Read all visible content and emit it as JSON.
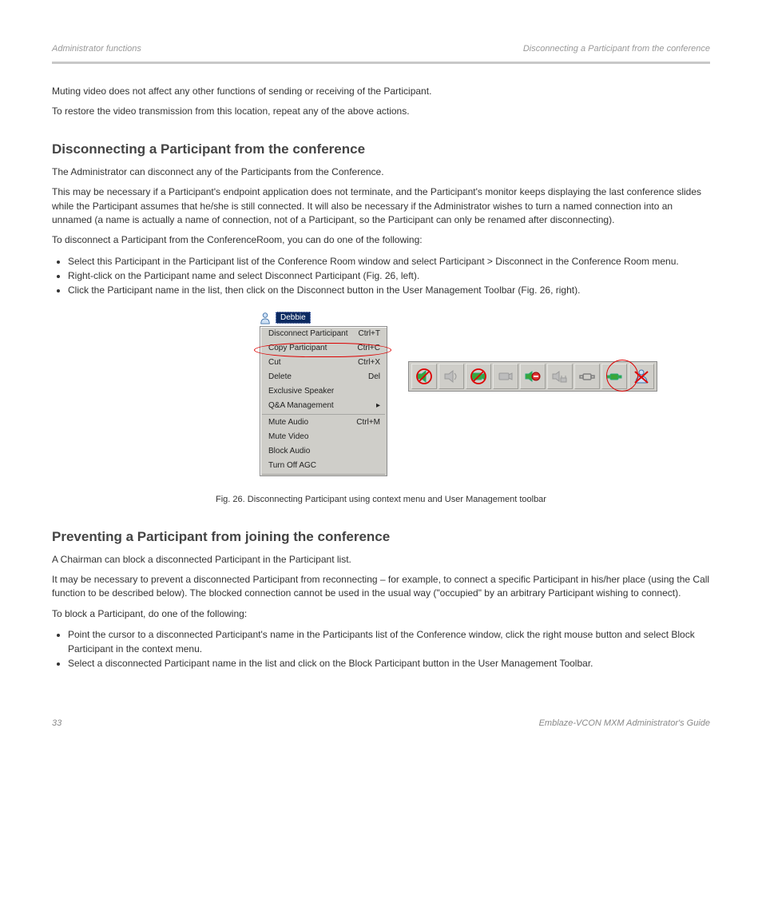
{
  "header": {
    "left": "Administrator functions",
    "right": "Disconnecting a Participant from the conference"
  },
  "intro_paragraphs": [
    "Muting video does not affect any other functions of sending or receiving of the Participant.",
    "To restore the video transmission from this location, repeat any of the above actions."
  ],
  "sections": [
    {
      "heading": "Disconnecting a Participant from the conference",
      "paragraphs": [
        "The Administrator can disconnect any of the Participants from the Conference.",
        "This may be necessary if a Participant's endpoint application does not terminate, and the Participant's monitor keeps displaying the last conference slides while the Participant assumes that he/she is still connected. It will also be necessary if the Administrator wishes to turn a named connection into an unnamed (a name is actually a name of connection, not of a Participant, so the Participant can only be renamed after disconnecting)."
      ],
      "action_intro": "To disconnect a Participant from the ConferenceRoom, you can do one of the following:",
      "bullets": [
        "Select this Participant in the Participant list of the Conference Room window and select Participant > Disconnect in the Conference Room menu.",
        "Right-click on the Participant name and select Disconnect Participant (Fig. 26, left).",
        "Click the Participant name in the list, then click on the Disconnect button in the User Management Toolbar (Fig. 26, right)."
      ],
      "fig_caption": "Fig. 26. Disconnecting Participant using context menu and User Management toolbar"
    },
    {
      "heading": "Preventing a Participant from joining the conference",
      "paragraphs": [
        "A Chairman can block a disconnected Participant in the Participant list.",
        "It may be necessary to prevent a disconnected Participant from reconnecting – for example, to connect a specific Participant in his/her place (using the Call function to be described below). The blocked connection cannot be used in the usual way (\"occupied\" by an arbitrary Participant wishing to connect)."
      ],
      "action_intro": "To block a Participant, do one of the following:",
      "bullets": [
        "Point the cursor to a disconnected Participant's name in the Participants list of the Conference window, click the right mouse button and select Block Participant in the context menu.",
        "Select a disconnected Participant name in the list and click on the Block Participant button in the User Management Toolbar."
      ]
    }
  ],
  "participant_name": "Debbie",
  "context_menu": {
    "items": [
      {
        "label": "Disconnect Participant",
        "shortcut": "Ctrl+T"
      },
      {
        "label": "Copy Participant",
        "shortcut": "Ctrl+C"
      },
      {
        "label": "Cut",
        "shortcut": "Ctrl+X"
      },
      {
        "label": "Delete",
        "shortcut": "Del"
      },
      {
        "label": "Exclusive Speaker",
        "shortcut": ""
      },
      {
        "label": "Q&A Management",
        "shortcut": "▸"
      }
    ],
    "items2": [
      {
        "label": "Mute Audio",
        "shortcut": "Ctrl+M"
      },
      {
        "label": "Mute Video",
        "shortcut": ""
      },
      {
        "label": "Block Audio",
        "shortcut": ""
      },
      {
        "label": "Turn Off AGC",
        "shortcut": ""
      }
    ]
  },
  "toolbar_icons": [
    "mute-audio-icon",
    "speaker-off-icon",
    "mute-video-icon",
    "camera-off-icon",
    "block-audio-icon",
    "agc-icon",
    "camera-control-icon",
    "disconnect-icon",
    "block-participant-icon"
  ],
  "footer": {
    "page": "33",
    "right": "Emblaze-VCON MXM Administrator's Guide"
  }
}
